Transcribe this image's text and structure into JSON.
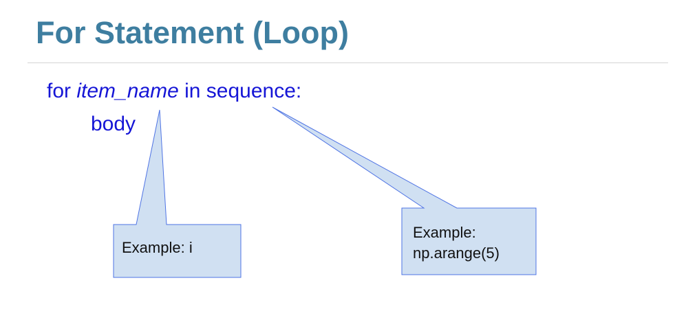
{
  "title": "For Statement (Loop)",
  "syntax": {
    "for_kw": "for",
    "item_name": "item_name",
    "in_sequence": "in sequence:",
    "body": "body"
  },
  "callouts": {
    "item_example": "Example:  i",
    "sequence_example_label": "Example:",
    "sequence_example_value": "np.arange(5)"
  },
  "colors": {
    "title": "#3e7ea0",
    "code": "#1515d6",
    "callout_fill": "#d0e0f2",
    "callout_border": "#4e73e4"
  }
}
